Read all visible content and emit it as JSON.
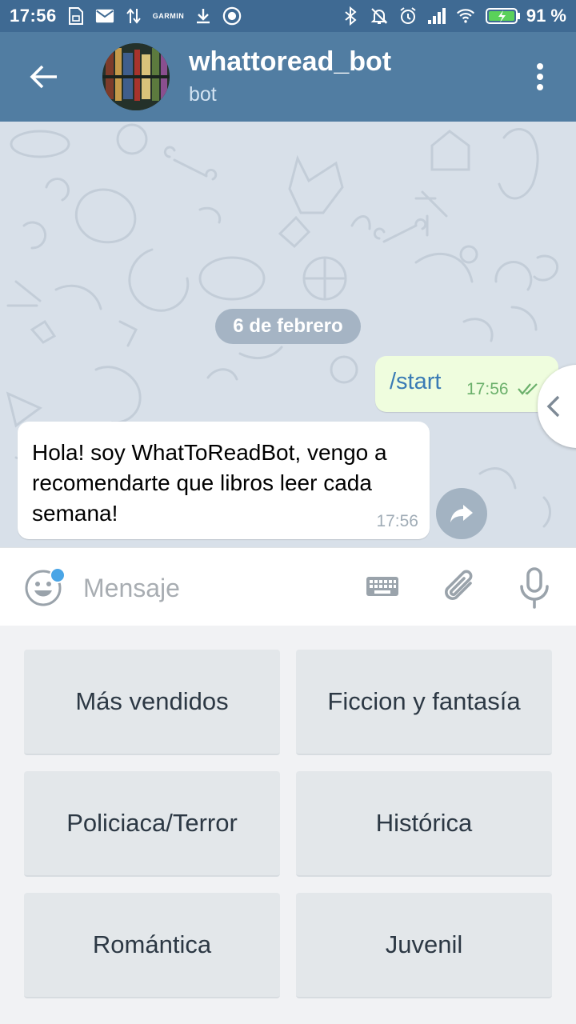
{
  "status_bar": {
    "time": "17:56",
    "garmin_label": "GARMIN",
    "battery_percent": "91 %",
    "icons": [
      "sim-card-icon",
      "mail-icon",
      "data-transfer-icon",
      "download-icon",
      "record-icon",
      "bluetooth-icon",
      "mute-icon",
      "alarm-icon",
      "signal-icon",
      "wifi-icon",
      "battery-charging-icon"
    ]
  },
  "header": {
    "title": "whattoread_bot",
    "subtitle": "bot",
    "icons": [
      "back-arrow-icon",
      "more-vertical-icon"
    ]
  },
  "chat": {
    "date_label": "6 de febrero",
    "messages": [
      {
        "direction": "out",
        "text": "/start",
        "time": "17:56",
        "status": "read"
      },
      {
        "direction": "in",
        "text": "Hola! soy WhatToReadBot, vengo a recomendarte que libros leer cada semana!",
        "time": "17:56"
      }
    ]
  },
  "input": {
    "placeholder": "Mensaje",
    "icons": [
      "emoji-icon",
      "keyboard-icon",
      "attach-icon",
      "mic-icon"
    ]
  },
  "keyboard": {
    "buttons": [
      "Más vendidos",
      "Ficcion y fantasía",
      "Policiaca/Terror",
      "Histórica",
      "Romántica",
      "Juvenil"
    ]
  },
  "colors": {
    "status_bar": "#3f6a93",
    "header": "#517da2",
    "chat_bg": "#d8e0e9",
    "outgoing_bubble": "#effdde",
    "incoming_bubble": "#ffffff",
    "keyboard_bg": "#f1f2f4",
    "keyboard_button": "#e3e7ea",
    "accent": "#4aa5e6"
  }
}
